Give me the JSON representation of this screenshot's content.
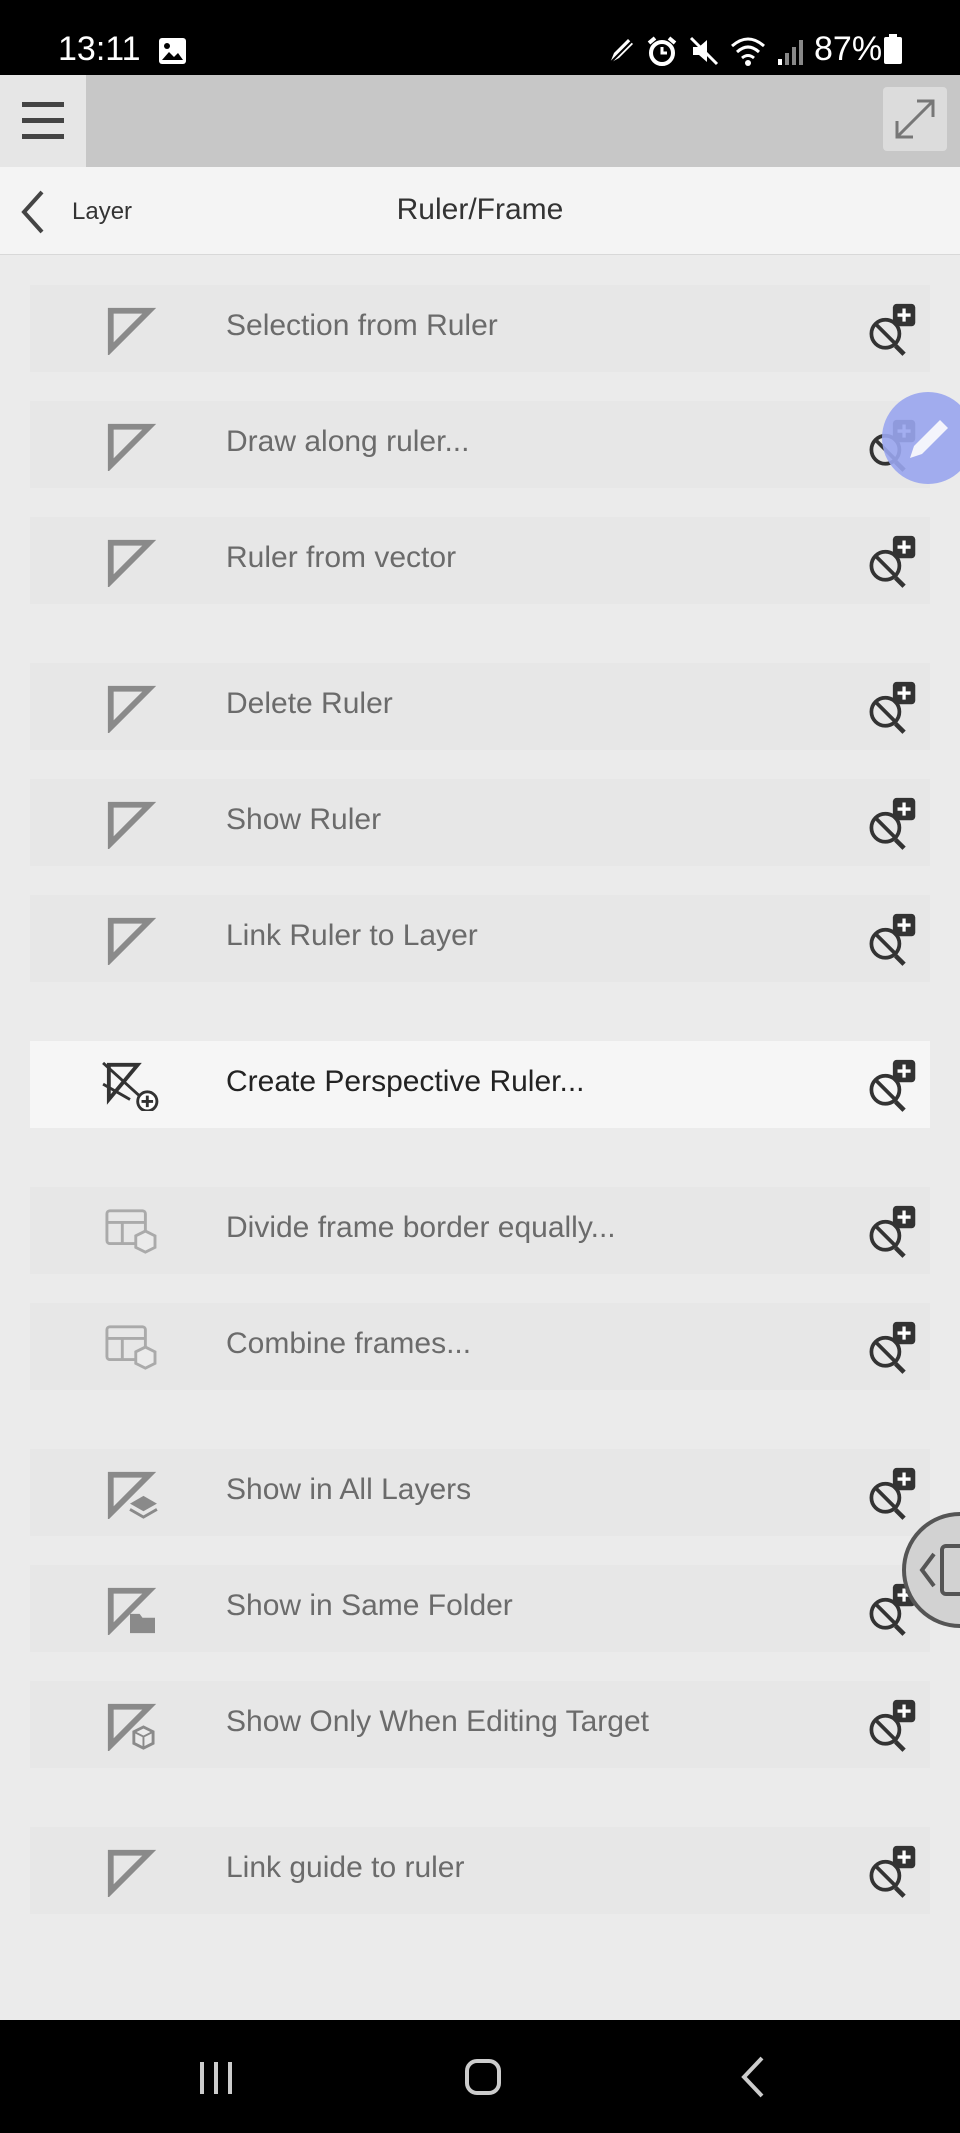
{
  "status_bar": {
    "time": "13:11",
    "battery": "87%",
    "icons": [
      "photo-icon",
      "pen-icon",
      "alarm-icon",
      "mute-icon",
      "wifi-icon",
      "signal-icon",
      "battery-icon"
    ]
  },
  "nav": {
    "back_label": "Layer",
    "title": "Ruler/Frame"
  },
  "items": [
    {
      "label": "Selection from Ruler",
      "icon": "ruler-icon"
    },
    {
      "label": "Draw along ruler...",
      "icon": "ruler-icon"
    },
    {
      "label": "Ruler from vector",
      "icon": "ruler-icon"
    },
    {
      "label": "Delete Ruler",
      "icon": "ruler-icon"
    },
    {
      "label": "Show Ruler",
      "icon": "ruler-icon"
    },
    {
      "label": "Link Ruler to Layer",
      "icon": "ruler-icon"
    },
    {
      "label": "Create Perspective Ruler...",
      "icon": "perspective-ruler-icon",
      "active": true
    },
    {
      "label": "Divide frame border equally...",
      "icon": "frame-icon"
    },
    {
      "label": "Combine frames...",
      "icon": "frame-icon"
    },
    {
      "label": "Show in All Layers",
      "icon": "ruler-layers-icon"
    },
    {
      "label": "Show in Same Folder",
      "icon": "ruler-folder-icon"
    },
    {
      "label": "Show Only When Editing Target",
      "icon": "ruler-target-icon"
    },
    {
      "label": "Link guide to ruler",
      "icon": "ruler-icon"
    }
  ],
  "colors": {
    "background": "#ebebeb",
    "row": "#e7e7e7",
    "active_row": "#f6f6f6",
    "float_button": "#9aa6ef"
  }
}
